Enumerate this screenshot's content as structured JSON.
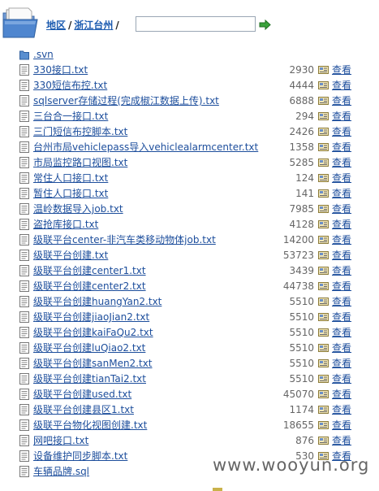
{
  "breadcrumb": {
    "root": "地区",
    "current": "浙江台州",
    "separator": "/"
  },
  "path_input": {
    "value": "",
    "placeholder": ""
  },
  "icons": {
    "folder": "folder-icon",
    "go": "go-arrow-icon",
    "file": "text-file-icon",
    "view": "view-icon"
  },
  "colors": {
    "link": "#1d4e9c",
    "folder_blue": "#5a8fd0",
    "go_green": "#39a23a"
  },
  "view_label": "查看",
  "files": [
    {
      "name": ".svn",
      "size": "",
      "is_folder": true
    },
    {
      "name": "330接口.txt",
      "size": "2930"
    },
    {
      "name": "330短信布控.txt",
      "size": "4444"
    },
    {
      "name": "sqlserver存储过程(完成椒江数据上传).txt",
      "size": "6888"
    },
    {
      "name": "三台合一接口.txt",
      "size": "294"
    },
    {
      "name": "三门短信布控脚本.txt",
      "size": "2426"
    },
    {
      "name": "台州市局vehiclepass导入vehiclealarmcenter.txt",
      "size": "1358"
    },
    {
      "name": "市局监控路口视图.txt",
      "size": "5285"
    },
    {
      "name": "常住人口接口.txt",
      "size": "124"
    },
    {
      "name": "暂住人口接口.txt",
      "size": "141"
    },
    {
      "name": "温岭数据导入job.txt",
      "size": "7985"
    },
    {
      "name": "盗抢库接口.txt",
      "size": "4128"
    },
    {
      "name": "级联平台center-非汽车类移动物体job.txt",
      "size": "14200"
    },
    {
      "name": "级联平台创建.txt",
      "size": "53723"
    },
    {
      "name": "级联平台创建center1.txt",
      "size": "3439"
    },
    {
      "name": "级联平台创建center2.txt",
      "size": "44738"
    },
    {
      "name": "级联平台创建huangYan2.txt",
      "size": "5510"
    },
    {
      "name": "级联平台创建jiaoJian2.txt",
      "size": "5510"
    },
    {
      "name": "级联平台创建kaiFaQu2.txt",
      "size": "5510"
    },
    {
      "name": "级联平台创建luQiao2.txt",
      "size": "5510"
    },
    {
      "name": "级联平台创建sanMen2.txt",
      "size": "5510"
    },
    {
      "name": "级联平台创建tianTai2.txt",
      "size": "5510"
    },
    {
      "name": "级联平台创建used.txt",
      "size": "45070"
    },
    {
      "name": "级联平台创建县区1.txt",
      "size": "1174"
    },
    {
      "name": "级联平台物化视图创建.txt",
      "size": "18655"
    },
    {
      "name": "网吧接口.txt",
      "size": "876"
    },
    {
      "name": "设备维护同步脚本.txt",
      "size": "530"
    },
    {
      "name": "车辆品牌.sql",
      "size": ""
    }
  ],
  "watermark": "www.wooyun.org"
}
